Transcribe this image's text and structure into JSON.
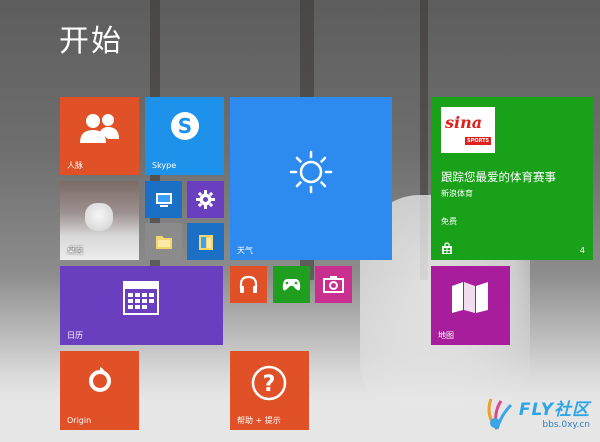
{
  "start": {
    "title": "开始"
  },
  "tiles": {
    "people": {
      "label": "人脉"
    },
    "skype": {
      "label": "Skype"
    },
    "weather": {
      "label": "天气"
    },
    "sports": {
      "headline": "跟踪您最爱的体育赛事",
      "source": "新浪体育",
      "price": "免费",
      "count": "4",
      "logo_text": "sina",
      "logo_sub": "SPORTS"
    },
    "desktop": {
      "label": "桌面"
    },
    "calendar": {
      "label": "日历"
    },
    "maps": {
      "label": "地图"
    },
    "origin": {
      "label": "Origin"
    },
    "help": {
      "label": "帮助 + 提示"
    }
  },
  "watermark": {
    "brand": "FLY社区",
    "url": "bbs.0xy.cn"
  },
  "colors": {
    "orange": "#e05127",
    "skype_blue": "#1e91ea",
    "weather_blue": "#2d8bf0",
    "purple": "#6a3fbf",
    "green": "#1aa11a",
    "magenta": "#a71d9c"
  }
}
